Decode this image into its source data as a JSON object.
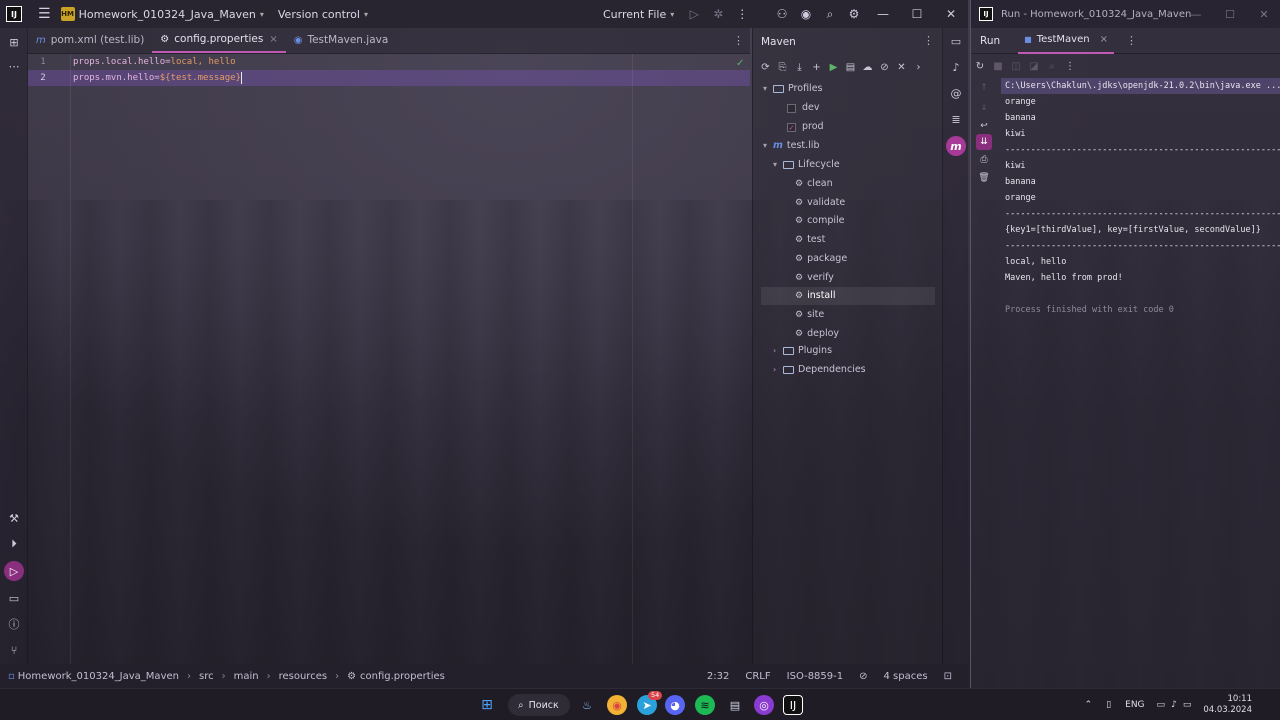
{
  "ide": {
    "logo": "IJ",
    "project_badge": "HM",
    "project_name": "Homework_010324_Java_Maven",
    "version_control": "Version control",
    "current_file": "Current File",
    "tabs": [
      {
        "label": "pom.xml (test.lib)",
        "icon": "maven-icon"
      },
      {
        "label": "config.properties",
        "icon": "gear-icon"
      },
      {
        "label": "TestMaven.java",
        "icon": "java-class-icon"
      }
    ],
    "code": {
      "lines": [
        {
          "num": "1",
          "key": "props.local.hello",
          "eq": "=",
          "value": "local, hello"
        },
        {
          "num": "2",
          "key": "props.mvn.hello",
          "eq": "=",
          "value": "${test.message}"
        }
      ]
    },
    "maven": {
      "title": "Maven",
      "profiles_label": "Profiles",
      "profiles": [
        {
          "name": "dev",
          "checked": false
        },
        {
          "name": "prod",
          "checked": true
        }
      ],
      "project": "test.lib",
      "lifecycle_label": "Lifecycle",
      "lifecycle": [
        "clean",
        "validate",
        "compile",
        "test",
        "package",
        "verify",
        "install",
        "site",
        "deploy"
      ],
      "selected_phase": "install",
      "plugins_label": "Plugins",
      "dependencies_label": "Dependencies"
    },
    "status": {
      "breadcrumb": [
        "Homework_010324_Java_Maven",
        "src",
        "main",
        "resources",
        "config.properties"
      ],
      "position": "2:32",
      "line_sep": "CRLF",
      "encoding": "ISO-8859-1",
      "indent": "4 spaces"
    }
  },
  "run": {
    "window_title": "Run - Homework_010324_Java_Maven",
    "run_label": "Run",
    "tab_label": "TestMaven",
    "console": [
      {
        "text": "C:\\Users\\Chaklun\\.jdks\\openjdk-21.0.2\\bin\\java.exe ...",
        "type": "cmd"
      },
      {
        "text": "orange",
        "type": "out"
      },
      {
        "text": "banana",
        "type": "out"
      },
      {
        "text": "kiwi",
        "type": "out"
      },
      {
        "text": "------------------------------------------------------",
        "type": "out"
      },
      {
        "text": "kiwi",
        "type": "out"
      },
      {
        "text": "banana",
        "type": "out"
      },
      {
        "text": "orange",
        "type": "out"
      },
      {
        "text": "------------------------------------------------------",
        "type": "out"
      },
      {
        "text": "{key1=[thirdValue], key=[firstValue, secondValue]}",
        "type": "out"
      },
      {
        "text": "------------------------------------------------------",
        "type": "out"
      },
      {
        "text": "local, hello",
        "type": "out"
      },
      {
        "text": "Maven, hello from prod!",
        "type": "out"
      },
      {
        "text": "",
        "type": "out"
      },
      {
        "text": "Process finished with exit code 0",
        "type": "gray"
      }
    ]
  },
  "taskbar": {
    "search_label": "Поиск",
    "telegram_badge": "54",
    "lang": "ENG",
    "time": "10:11",
    "date": "04.03.2024"
  },
  "colors": {
    "accent": "#c059b4",
    "maven_active": "#a73a98",
    "property_key": "#e4b4e0",
    "property_value": "#e49b66"
  }
}
